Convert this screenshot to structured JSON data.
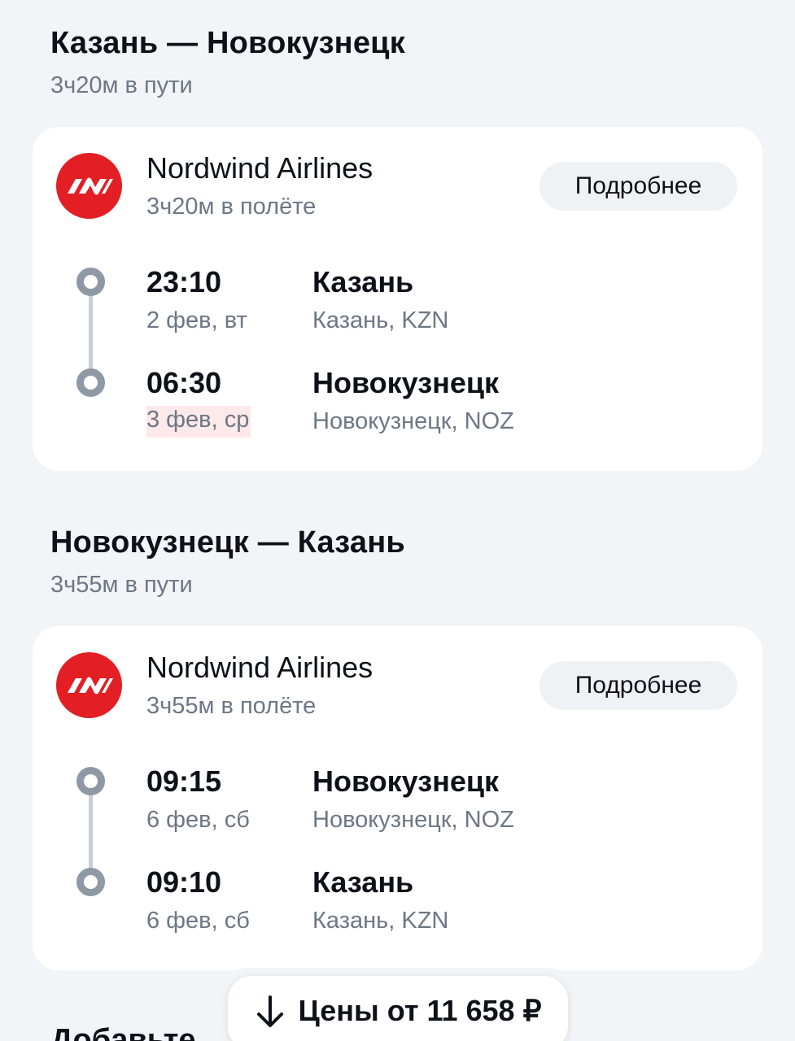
{
  "colors": {
    "background": "#f2f4f7",
    "card": "#ffffff",
    "primary_text": "#0d1118",
    "secondary_text": "#6d7785",
    "airline_brand": "#e31e24",
    "date_change_highlight": "#fde8ea",
    "timeline": "#8f98a5"
  },
  "outbound": {
    "route_title": "Казань — Новокузнецк",
    "total_duration": "3ч20м в пути",
    "airline": {
      "name": "Nordwind Airlines",
      "logo_icon": "nordwind-logo-icon",
      "flight_duration": "3ч20м в полёте"
    },
    "details_label": "Подробнее",
    "departure": {
      "time": "23:10",
      "date": "2 фев, вт",
      "city": "Казань",
      "airport": "Казань, KZN"
    },
    "arrival": {
      "time": "06:30",
      "date": "3 фев, ср",
      "city": "Новокузнецк",
      "airport": "Новокузнецк, NOZ",
      "date_highlighted": true
    }
  },
  "return": {
    "route_title": "Новокузнецк — Казань",
    "total_duration": "3ч55м в пути",
    "airline": {
      "name": "Nordwind Airlines",
      "logo_icon": "nordwind-logo-icon",
      "flight_duration": "3ч55м в полёте"
    },
    "details_label": "Подробнее",
    "departure": {
      "time": "09:15",
      "date": "6 фев, сб",
      "city": "Новокузнецк",
      "airport": "Новокузнецк, NOZ"
    },
    "arrival": {
      "time": "09:10",
      "date": "6 фев, сб",
      "city": "Казань",
      "airport": "Казань, KZN"
    }
  },
  "price_button": {
    "icon": "arrow-down-icon",
    "label": "Цены от 11 658 ₽"
  },
  "next_section_peek": "Добавьте"
}
